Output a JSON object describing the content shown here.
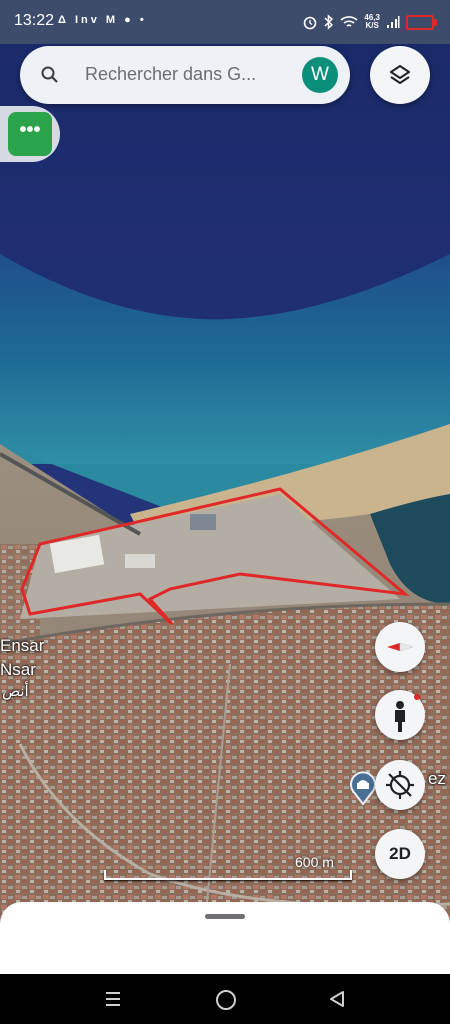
{
  "status_bar": {
    "time": "13:22",
    "notifications": "Δ Inv M ● •",
    "speed_value": "46,3",
    "speed_unit": "K/S",
    "icons": [
      "alarm-icon",
      "bluetooth-icon",
      "wifi-icon",
      "signal-icon",
      "battery-icon"
    ],
    "battery_color": "#e02828"
  },
  "search": {
    "placeholder": "Rechercher dans G...",
    "avatar_letter": "W",
    "avatar_color": "#0b8f7a"
  },
  "map": {
    "place_labels": [
      {
        "text": "Ensar"
      },
      {
        "text": "Nsar"
      },
      {
        "text": "أنص"
      },
      {
        "text": "ez"
      }
    ],
    "scale_label": "600 m",
    "outline_color": "#e02828",
    "icons": [
      "compass-icon",
      "pegman-icon",
      "location-off-icon",
      "mosque-pin-icon"
    ]
  },
  "controls": {
    "dimension_toggle": "2D",
    "more_button": "•••"
  },
  "navbar": {
    "icons": [
      "recents-icon",
      "home-icon",
      "back-icon"
    ]
  }
}
